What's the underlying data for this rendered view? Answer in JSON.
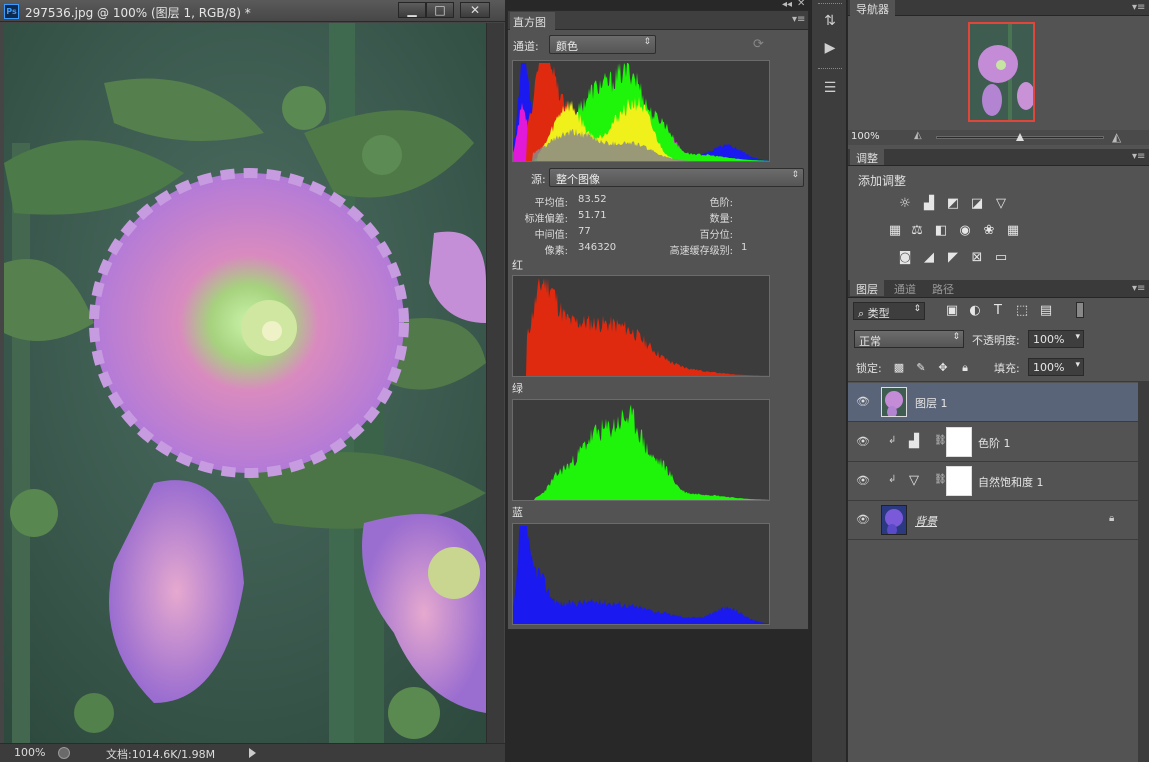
{
  "document": {
    "title": "297536.jpg @ 100% (图层 1, RGB/8) *",
    "ps_badge": "Ps",
    "minimize": "▁",
    "maximize": "□",
    "close": "✕",
    "status": {
      "zoom": "100%",
      "doc_info": "文档:1014.6K/1.98M"
    }
  },
  "histogram": {
    "tab": "直方图",
    "channel_label": "通道:",
    "channel_value": "颜色",
    "source_label": "源:",
    "source_value": "整个图像",
    "stats": {
      "mean_label": "平均值:",
      "mean": "83.52",
      "std_label": "标准偏差:",
      "std": "51.71",
      "median_label": "中间值:",
      "median": "77",
      "pixels_label": "像素:",
      "pixels": "346320",
      "levels_label": "色阶:",
      "count_label": "数量:",
      "percentile_label": "百分位:",
      "cache_label": "高速缓存级别:",
      "cache": "1"
    },
    "red_label": "红",
    "green_label": "绿",
    "blue_label": "蓝",
    "colors": {
      "red": "#e02a10",
      "green": "#1ef50a",
      "blue": "#1a1af0",
      "yellow": "#f0f01a",
      "magenta": "#e01ad8",
      "gray": "#8a8a8a"
    }
  },
  "navigator": {
    "tab": "导航器",
    "zoom": "100%"
  },
  "adjustments": {
    "tab": "调整",
    "heading": "添加调整"
  },
  "layers_panel": {
    "tabs": [
      "图层",
      "通道",
      "路径"
    ],
    "filter_value": "类型",
    "blend_mode": "正常",
    "opacity_label": "不透明度:",
    "opacity": "100%",
    "lock_label": "锁定:",
    "fill_label": "填充:",
    "fill": "100%",
    "layers": [
      {
        "name": "图层 1",
        "selected": true
      },
      {
        "name": "色阶 1"
      },
      {
        "name": "自然饱和度 1"
      },
      {
        "name": "背景"
      }
    ]
  },
  "chart_data": [
    {
      "type": "area",
      "title": "红",
      "xlim": [
        0,
        255
      ]
    },
    {
      "type": "area",
      "title": "绿",
      "xlim": [
        0,
        255
      ]
    },
    {
      "type": "area",
      "title": "蓝",
      "xlim": [
        0,
        255
      ]
    }
  ]
}
